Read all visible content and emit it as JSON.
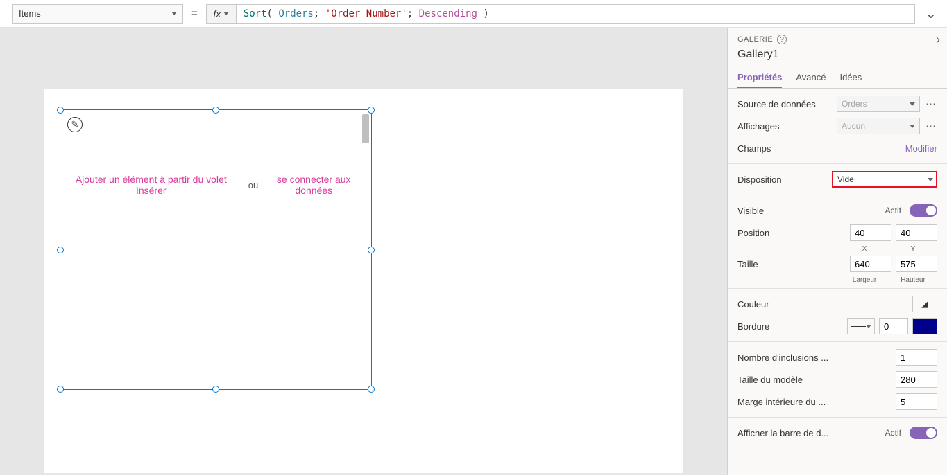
{
  "formula_bar": {
    "property": "Items",
    "fn": "Sort",
    "arg1": "Orders",
    "arg2": "'Order Number'",
    "arg3": "Descending"
  },
  "canvas": {
    "add_from_insert": "Ajouter un élément à partir du volet Insérer",
    "or": "ou",
    "connect_data": "se connecter aux données"
  },
  "panel": {
    "header": "GALERIE",
    "title": "Gallery1",
    "tabs": {
      "properties": "Propriétés",
      "advanced": "Avancé",
      "ideas": "Idées"
    },
    "datasource_label": "Source de données",
    "datasource_value": "Orders",
    "views_label": "Affichages",
    "views_value": "Aucun",
    "fields_label": "Champs",
    "fields_action": "Modifier",
    "layout_label": "Disposition",
    "layout_value": "Vide",
    "visible_label": "Visible",
    "toggle_on": "Actif",
    "position_label": "Position",
    "pos_x": "40",
    "pos_y": "40",
    "x_label": "X",
    "y_label": "Y",
    "size_label": "Taille",
    "width": "640",
    "height": "575",
    "width_label": "Largeur",
    "height_label": "Hauteur",
    "color_label": "Couleur",
    "border_label": "Bordure",
    "border_width": "0",
    "wrap_label": "Nombre d'inclusions ...",
    "wrap_value": "1",
    "template_label": "Taille du modèle",
    "template_value": "280",
    "padding_label": "Marge intérieure du ...",
    "padding_value": "5",
    "scrollbar_label": "Afficher la barre de d..."
  }
}
